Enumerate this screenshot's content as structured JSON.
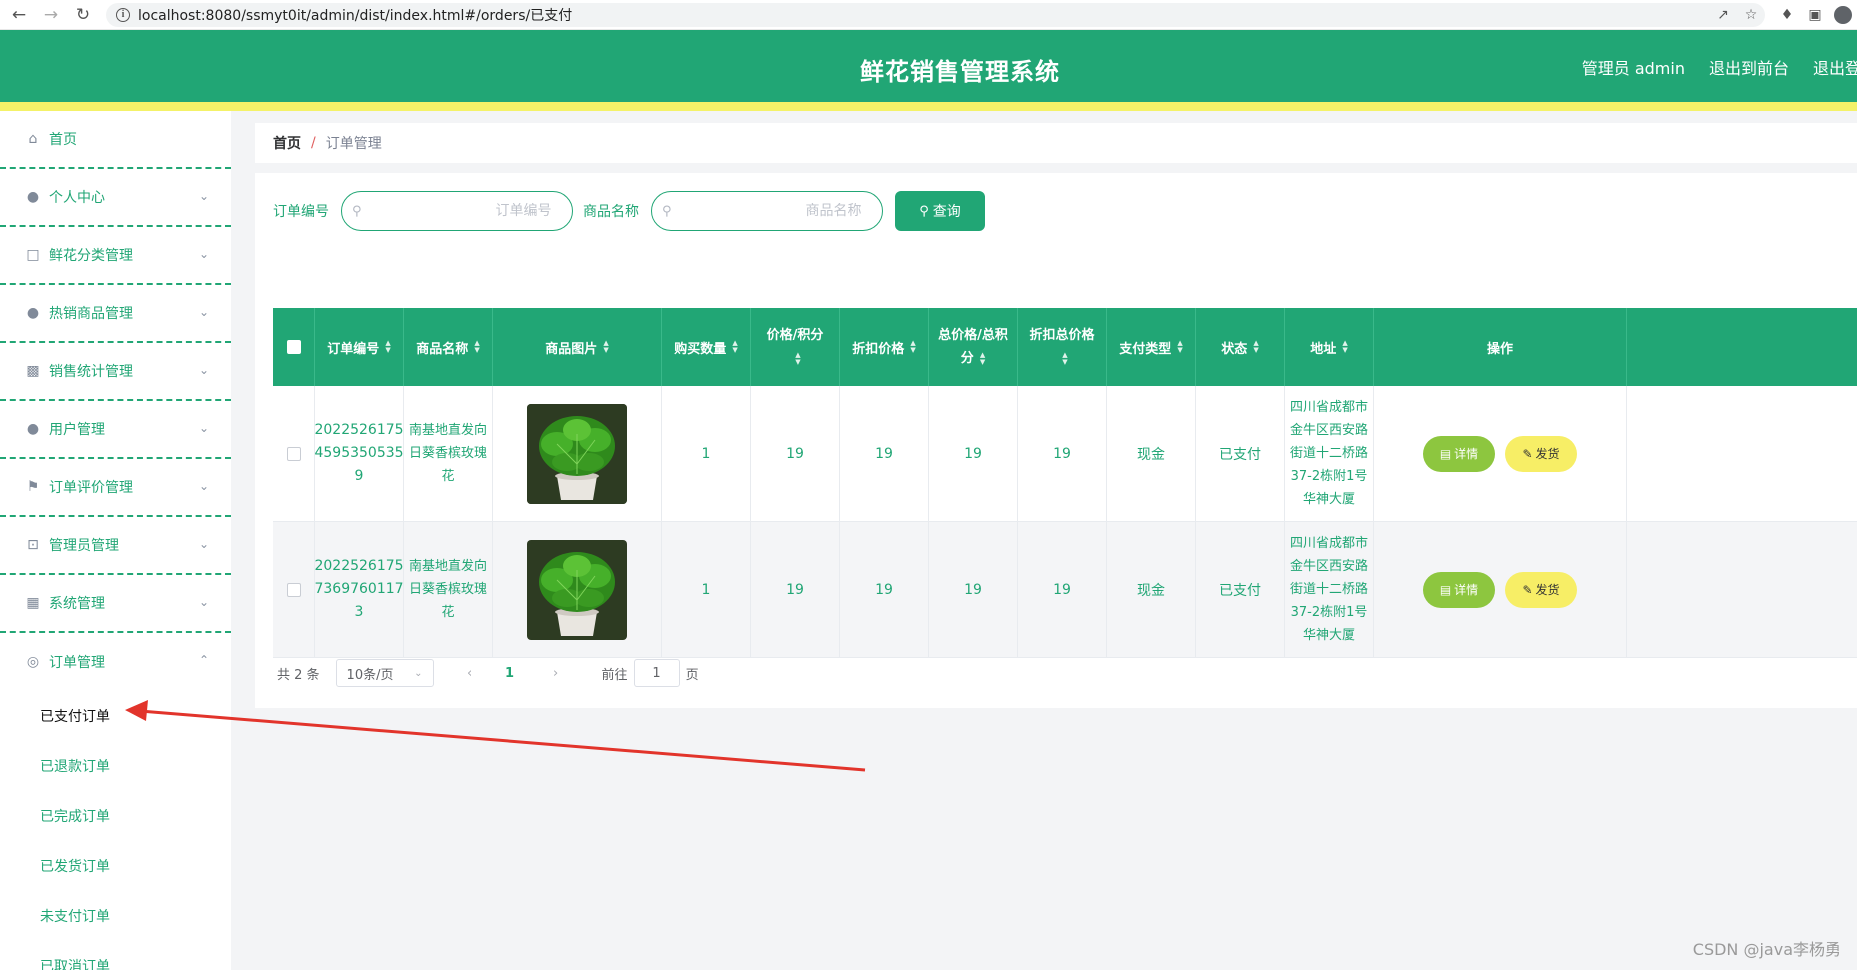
{
  "browser": {
    "url": "localhost:8080/ssmyt0it/admin/dist/index.html#/orders/已支付"
  },
  "header": {
    "title": "鲜花销售管理系统",
    "admin_label": "管理员 admin",
    "back_front": "退出到前台",
    "logout": "退出登录"
  },
  "sidebar": {
    "items": [
      {
        "label": "首页",
        "icon": "home-icon"
      },
      {
        "label": "个人中心",
        "icon": "user-icon"
      },
      {
        "label": "鲜花分类管理",
        "icon": "chat-icon"
      },
      {
        "label": "热销商品管理",
        "icon": "user-icon"
      },
      {
        "label": "销售统计管理",
        "icon": "briefcase-icon"
      },
      {
        "label": "用户管理",
        "icon": "user-icon"
      },
      {
        "label": "订单评价管理",
        "icon": "flag-icon"
      },
      {
        "label": "管理员管理",
        "icon": "crop-icon"
      },
      {
        "label": "系统管理",
        "icon": "grid-icon"
      },
      {
        "label": "订单管理",
        "icon": "target-icon"
      }
    ],
    "submenu": [
      "已支付订单",
      "已退款订单",
      "已完成订单",
      "已发货订单",
      "未支付订单",
      "已取消订单"
    ]
  },
  "breadcrumb": {
    "home": "首页",
    "sep": "/",
    "current": "订单管理"
  },
  "search": {
    "order_no_label": "订单编号",
    "order_no_placeholder": "订单编号",
    "product_label": "商品名称",
    "product_placeholder": "商品名称",
    "query_button": "查询"
  },
  "table": {
    "headers": [
      "订单编号",
      "商品名称",
      "商品图片",
      "购买数量",
      "价格/积分",
      "折扣价格",
      "总价格/总积分",
      "折扣总价格",
      "支付类型",
      "状态",
      "地址",
      "操作"
    ],
    "rows": [
      {
        "order_no": "20225261754595350535 9",
        "order_no_display": "2022526175\n4595350535\n9",
        "product": "南基地直发向日葵香槟玫瑰花",
        "product_display": "南基地直发向\n日葵香槟玫瑰\n花",
        "qty": "1",
        "price": "19",
        "discount_price": "19",
        "total": "19",
        "discount_total": "19",
        "pay_type": "现金",
        "status": "已支付",
        "address_display": "四川省成都市\n金牛区西安路\n街道十二桥路\n37-2栋附1号\n华神大厦"
      },
      {
        "order_no_display": "2022526175\n7369760117\n3",
        "product_display": "南基地直发向\n日葵香槟玫瑰\n花",
        "qty": "1",
        "price": "19",
        "discount_price": "19",
        "total": "19",
        "discount_total": "19",
        "pay_type": "现金",
        "status": "已支付",
        "address_display": "四川省成都市\n金牛区西安路\n街道十二桥路\n37-2栋附1号\n华神大厦"
      }
    ],
    "detail_button": "详情",
    "ship_button": "发货"
  },
  "pager": {
    "total": "共 2 条",
    "page_size": "10条/页",
    "current": "1",
    "goto_label": "前往",
    "goto_value": "1",
    "page_suffix": "页"
  },
  "watermark": "CSDN @java李杨勇",
  "colors": {
    "primary": "#21a675",
    "accent_yellow": "#f4f268",
    "detail_green": "#8dc63f",
    "ship_yellow": "#f7ee66"
  }
}
